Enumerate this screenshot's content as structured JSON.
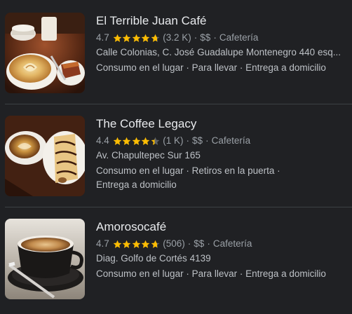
{
  "results": [
    {
      "name": "El Terrible Juan Café",
      "rating": "4.7",
      "rating_value": 4.7,
      "review_count": "(3.2 K)",
      "price": "$$",
      "category": "Cafetería",
      "address": "Calle Colonias, C. José Guadalupe Montenegro 440 esq...",
      "services_line1": "Consumo en el lugar · Para llevar · Entrega a domicilio",
      "services_line2": "",
      "image_icon": "coffee-latte-art-photo"
    },
    {
      "name": "The Coffee Legacy",
      "rating": "4.4",
      "rating_value": 4.4,
      "review_count": "(1 K)",
      "price": "$$",
      "category": "Cafetería",
      "address": "Av. Chapultepec Sur 165",
      "services_line1": "Consumo en el lugar · Retiros en la puerta ·",
      "services_line2": "Entrega a domicilio",
      "image_icon": "coffee-and-crepe-photo"
    },
    {
      "name": "Amorosocafé",
      "rating": "4.7",
      "rating_value": 4.7,
      "review_count": "(506)",
      "price": "$$",
      "category": "Cafetería",
      "address": "Diag. Golfo de Cortés 4139",
      "services_line1": "Consumo en el lugar · Para llevar · Entrega a domicilio",
      "services_line2": "",
      "image_icon": "espresso-cup-photo"
    }
  ],
  "separator": "·",
  "colors": {
    "background": "#202124",
    "star": "#fbbc04",
    "star_empty": "#5f6368",
    "title": "#e8eaed",
    "secondary": "#9aa0a6",
    "divider": "#3c4043"
  }
}
